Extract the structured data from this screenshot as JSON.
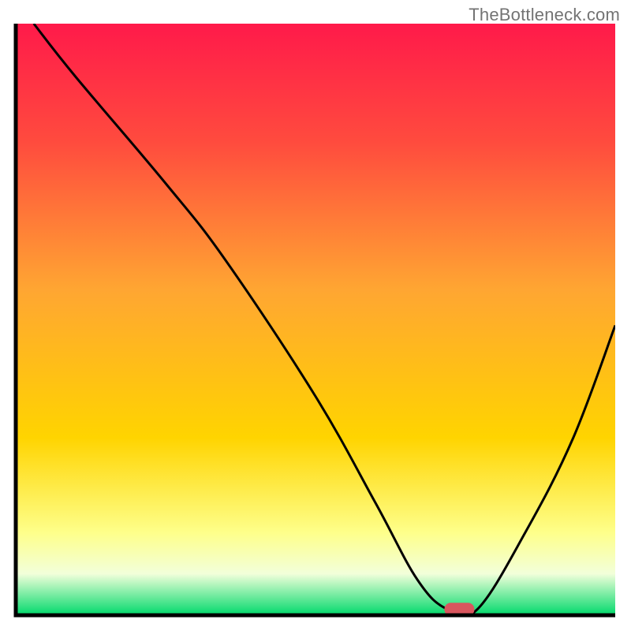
{
  "watermark": "TheBottleneck.com",
  "chart_data": {
    "type": "line",
    "title": "",
    "xlabel": "",
    "ylabel": "",
    "xlim": [
      0,
      100
    ],
    "ylim": [
      0,
      100
    ],
    "grid": false,
    "colors": {
      "gradient_top": "#ff1a4a",
      "gradient_mid": "#ffd400",
      "gradient_bottom": "#00d96b",
      "curve": "#000000",
      "marker": "#d9565e",
      "frame": "#000000"
    },
    "series": [
      {
        "name": "curve",
        "x": [
          3,
          10,
          25,
          35,
          50,
          60,
          67,
          72,
          77,
          85,
          93,
          100
        ],
        "y": [
          100,
          91,
          73,
          60,
          37,
          19,
          6,
          1,
          1,
          14,
          30,
          49
        ]
      }
    ],
    "marker": {
      "x": 74,
      "y": 1,
      "w": 5,
      "h": 2.2
    },
    "annotations": []
  }
}
